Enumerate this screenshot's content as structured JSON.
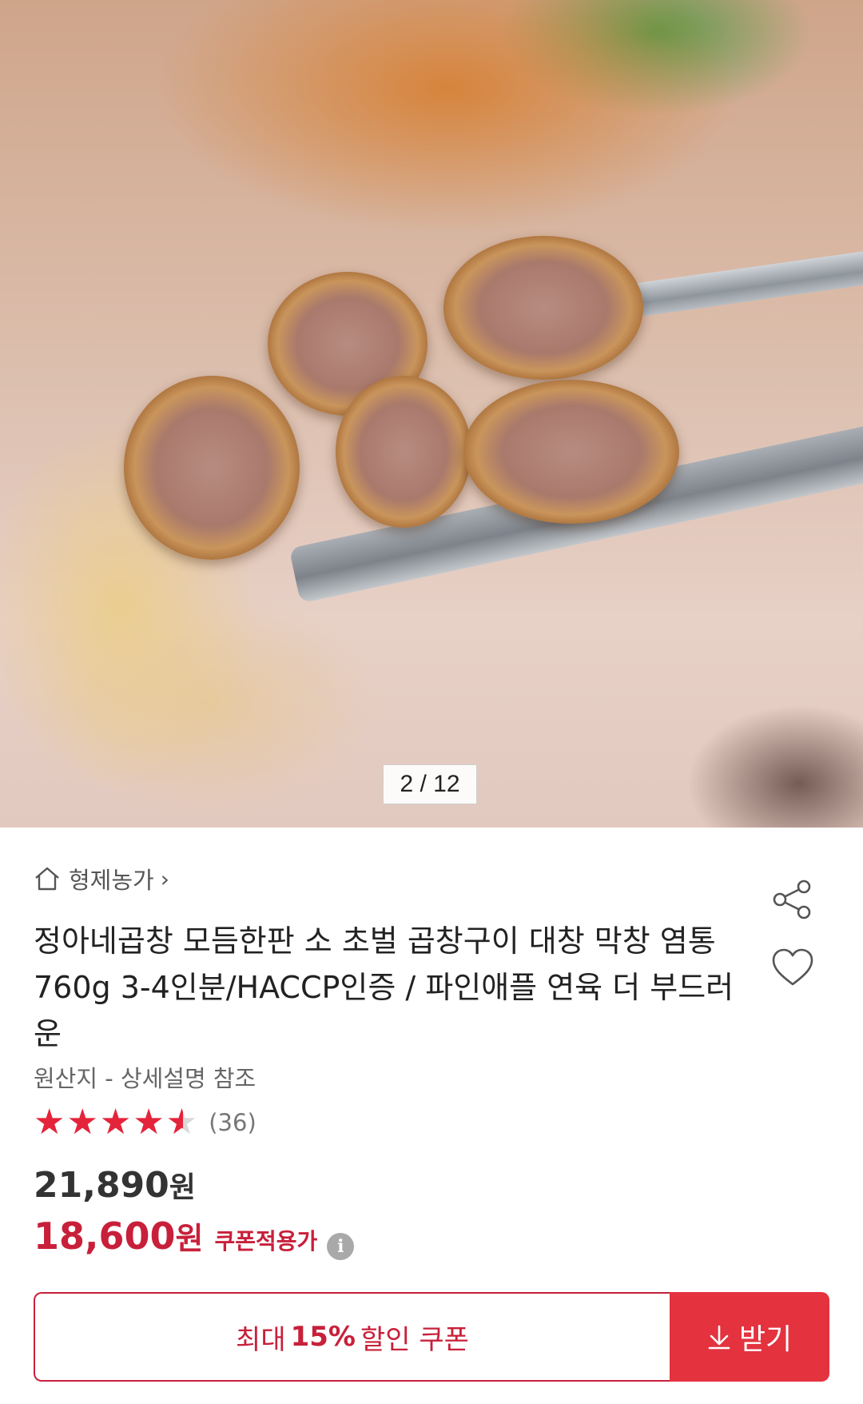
{
  "gallery": {
    "current": "2",
    "separator": "/",
    "total": "12",
    "indicator_text": "2 / 12"
  },
  "store": {
    "name": "형제농가",
    "icon": "home-icon",
    "chevron": "›"
  },
  "product": {
    "title": "정아네곱창 모듬한판 소 초벌 곱창구이 대창 막창 염통 760g 3-4인분/HACCP인증 / 파인애플 연육 더 부드러운",
    "origin": "원산지 - 상세설명 참조"
  },
  "rating": {
    "value": 4.5,
    "max": 5,
    "stars_text": "★★★★★",
    "review_count": "(36)"
  },
  "price": {
    "original_amount": "21,890",
    "sale_amount": "18,600",
    "unit": "원",
    "coupon_applied_label": "쿠폰적용가",
    "info_glyph": "i"
  },
  "coupon": {
    "prefix": "최대",
    "percent": "15%",
    "suffix": "할인 쿠폰",
    "button_label": "받기"
  },
  "actions": {
    "share_icon": "share-icon",
    "wishlist_icon": "heart-icon"
  },
  "colors": {
    "accent": "#c8203a",
    "button": "#e4323f",
    "star": "#e4243a"
  }
}
